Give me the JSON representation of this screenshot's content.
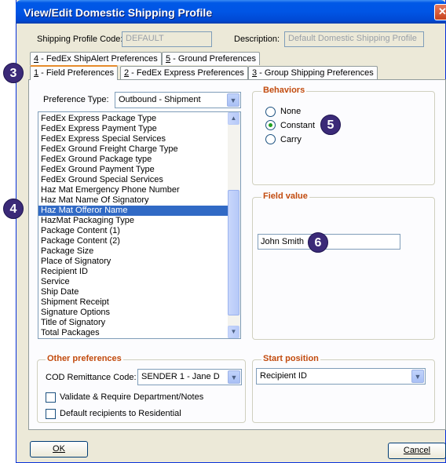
{
  "window": {
    "title": "View/Edit Domestic Shipping Profile",
    "close_glyph": "✕"
  },
  "header": {
    "code_label": "Shipping Profile Code:",
    "code_value": "DEFAULT",
    "desc_label": "Description:",
    "desc_value": "Default Domestic Shipping Profile"
  },
  "tabs": {
    "row1": [
      {
        "key": "4",
        "label": " - FedEx ShipAlert Preferences"
      },
      {
        "key": "5",
        "label": " - Ground Preferences"
      }
    ],
    "row2": [
      {
        "key": "1",
        "label": " - Field Preferences"
      },
      {
        "key": "2",
        "label": " - FedEx Express Preferences"
      },
      {
        "key": "3",
        "label": " - Group Shipping Preferences"
      }
    ]
  },
  "preference_type": {
    "label": "Preference Type:",
    "value": "Outbound - Shipment"
  },
  "field_list": {
    "items": [
      "FedEx Express Package Type",
      "FedEx Express Payment Type",
      "FedEx Express Special Services",
      "FedEx Ground Freight Charge Type",
      "FedEx Ground Package type",
      "FedEx Ground Payment Type",
      "FedEx Ground Special Services",
      "Haz Mat Emergency Phone Number",
      "Haz Mat Name Of Signatory",
      "Haz Mat Offeror Name",
      "HazMat Packaging Type",
      "Package Content (1)",
      "Package Content (2)",
      "Package Size",
      "Place of Signatory",
      "Recipient ID",
      "Service",
      "Ship Date",
      "Shipment Receipt",
      "Signature Options",
      "Title of Signatory",
      "Total Packages"
    ],
    "selected": "Haz Mat Offeror Name"
  },
  "behaviors": {
    "title": "Behaviors",
    "options": [
      "None",
      "Constant",
      "Carry"
    ],
    "selected": "Constant"
  },
  "field_value": {
    "title": "Field value",
    "value": "John Smith"
  },
  "other_preferences": {
    "title": "Other preferences",
    "cod_label": "COD Remittance Code:",
    "cod_value": "SENDER  1 - Jane D",
    "validate_label": "Validate & Require Department/Notes",
    "residential_label": "Default recipients to Residential"
  },
  "start_position": {
    "title": "Start position",
    "value": "Recipient ID"
  },
  "buttons": {
    "ok": "OK",
    "cancel": "Cancel"
  },
  "callouts": [
    "3",
    "4",
    "5",
    "6"
  ],
  "colors": {
    "title_bar": "#0055e5",
    "group_title": "#c24b0e",
    "selection": "#316ac5",
    "callout": "#3b2a78"
  }
}
